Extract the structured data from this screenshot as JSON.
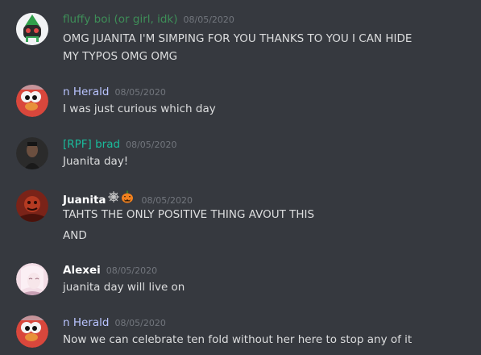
{
  "messages": [
    {
      "author": "fluffy boi (or girl, idk)",
      "author_color": "#3e8e58",
      "timestamp": "08/05/2020",
      "lines": [
        "OMG JUANITA I'M SIMPING FOR YOU THANKS TO YOU I CAN HIDE",
        "MY TYPOS OMG OMG"
      ]
    },
    {
      "author": "n Herald",
      "author_color": "#b9c4ff",
      "timestamp": "08/05/2020",
      "lines": [
        "I was just curious which day"
      ]
    },
    {
      "author": "[RPF] brad",
      "author_color": "#1abc9c",
      "timestamp": "08/05/2020",
      "lines": [
        "Juanita day!"
      ]
    },
    {
      "author": "Juanita",
      "author_color": "#ffffff",
      "author_emojis": [
        "spiderweb-icon",
        "jack-o-lantern-icon"
      ],
      "timestamp": "08/05/2020",
      "lines": [
        "TAHTS THE ONLY POSITIVE THING AVOUT THIS",
        "AND"
      ]
    },
    {
      "author": "Alexei",
      "author_color": "#ffffff",
      "timestamp": "08/05/2020",
      "lines": [
        "juanita day will live on"
      ]
    },
    {
      "author": "n Herald",
      "author_color": "#b9c4ff",
      "timestamp": "08/05/2020",
      "lines": [
        "Now we can celebrate ten fold without her here to stop any of it"
      ]
    }
  ]
}
